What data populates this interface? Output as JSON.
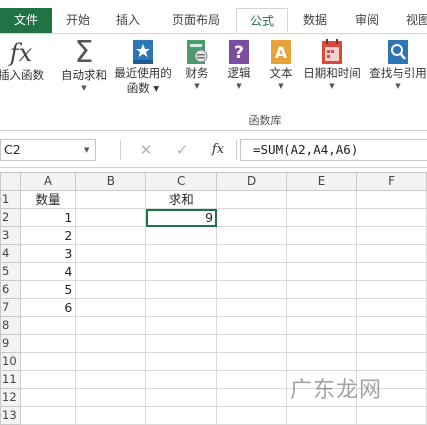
{
  "tabs": {
    "file": "文件",
    "home": "开始",
    "insert": "插入",
    "page_layout": "页面布局",
    "formulas": "公式",
    "data": "数据",
    "review": "审阅",
    "view": "视图"
  },
  "ribbon": {
    "insert_function": "插入函数",
    "autosum": "自动求和",
    "recently_used_line1": "最近使用的",
    "recently_used_line2": "函数",
    "financial": "财务",
    "logical": "逻辑",
    "text": "文本",
    "date_time": "日期和时间",
    "lookup_ref": "查找与引用",
    "group_label": "函数库"
  },
  "formula_bar": {
    "name_box": "C2",
    "cancel_icon": "✕",
    "enter_icon": "✓",
    "fx": "fx",
    "formula": "=SUM(A2,A4,A6)"
  },
  "columns": [
    "A",
    "B",
    "C",
    "D",
    "E",
    "F"
  ],
  "rows": [
    {
      "n": "1",
      "cells": [
        "数量",
        "",
        "求和",
        "",
        "",
        ""
      ]
    },
    {
      "n": "2",
      "cells": [
        "1",
        "",
        "9",
        "",
        "",
        ""
      ]
    },
    {
      "n": "3",
      "cells": [
        "2",
        "",
        "",
        "",
        "",
        ""
      ]
    },
    {
      "n": "4",
      "cells": [
        "3",
        "",
        "",
        "",
        "",
        ""
      ]
    },
    {
      "n": "5",
      "cells": [
        "4",
        "",
        "",
        "",
        "",
        ""
      ]
    },
    {
      "n": "6",
      "cells": [
        "5",
        "",
        "",
        "",
        "",
        ""
      ]
    },
    {
      "n": "7",
      "cells": [
        "6",
        "",
        "",
        "",
        "",
        ""
      ]
    },
    {
      "n": "8",
      "cells": [
        "",
        "",
        "",
        "",
        "",
        ""
      ]
    },
    {
      "n": "9",
      "cells": [
        "",
        "",
        "",
        "",
        "",
        ""
      ]
    },
    {
      "n": "10",
      "cells": [
        "",
        "",
        "",
        "",
        "",
        ""
      ]
    },
    {
      "n": "11",
      "cells": [
        "",
        "",
        "",
        "",
        "",
        ""
      ]
    },
    {
      "n": "12",
      "cells": [
        "",
        "",
        "",
        "",
        "",
        ""
      ]
    },
    {
      "n": "13",
      "cells": [
        "",
        "",
        "",
        "",
        "",
        ""
      ]
    }
  ],
  "watermark": "广东龙网",
  "colors": {
    "excel_green": "#217346",
    "autosum_sigma": "#555555",
    "recent_star": "#2e75b6",
    "financial": "#4a9b6e",
    "logical": "#7b4fa0",
    "text": "#e8a23a",
    "date_time": "#d9483b",
    "lookup": "#2e75b6"
  }
}
